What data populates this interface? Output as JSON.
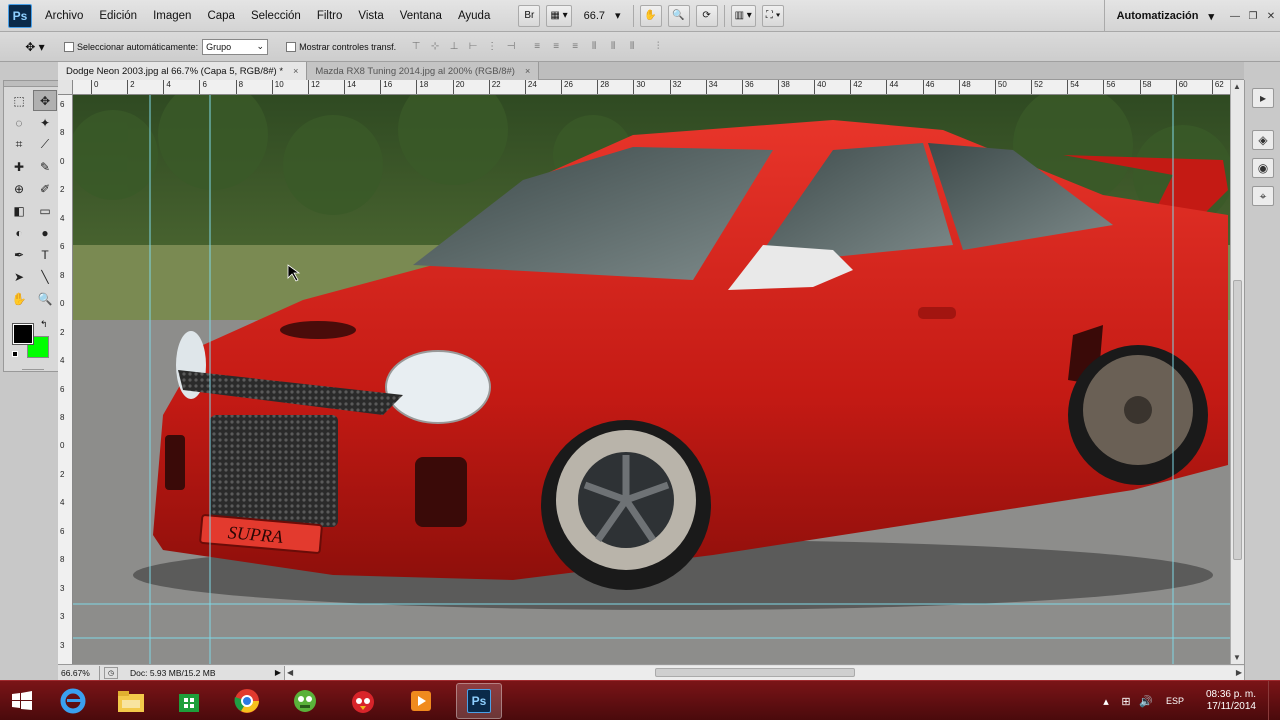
{
  "menubar": {
    "app_logo": "Ps",
    "items": [
      "Archivo",
      "Edición",
      "Imagen",
      "Capa",
      "Selección",
      "Filtro",
      "Vista",
      "Ventana",
      "Ayuda"
    ],
    "bridge_label": "Br",
    "zoom": "66.7",
    "automation": "Automatización"
  },
  "options": {
    "auto_select_label": "Seleccionar automáticamente:",
    "auto_select_value": "Grupo",
    "show_transform_label": "Mostrar controles transf."
  },
  "tabs": [
    {
      "label": "Dodge Neon 2003.jpg al 66.7% (Capa 5, RGB/8#) *",
      "close": "×"
    },
    {
      "label": "Mazda RX8 Tuning 2014.jpg al 200% (RGB/8#)",
      "close": "×"
    }
  ],
  "ruler_top": [
    "0",
    "2",
    "4",
    "6",
    "8",
    "10",
    "12",
    "14",
    "16",
    "18",
    "20",
    "22",
    "24",
    "26",
    "28",
    "30",
    "32",
    "34",
    "36",
    "38",
    "40",
    "42",
    "44",
    "46",
    "48",
    "50",
    "52",
    "54",
    "56",
    "58",
    "60",
    "62"
  ],
  "ruler_left": [
    "6",
    "8",
    "0",
    "2",
    "4",
    "6",
    "8",
    "0",
    "2",
    "4",
    "6",
    "8",
    "0",
    "2",
    "4",
    "6",
    "8",
    "3",
    "3",
    "3"
  ],
  "image": {
    "plate_text": "SUPRA"
  },
  "colors": {
    "foreground": "#000000",
    "background": "#00ff00",
    "car_body": "#d8201a",
    "taskbar": "#6a1012"
  },
  "status": {
    "zoom": "66.67%",
    "doc": "Doc: 5.93 MB/15.2 MB"
  },
  "taskbar": {
    "apps": [
      "ie-icon",
      "explorer-icon",
      "store-icon",
      "chrome-icon",
      "game-icon",
      "angry-birds-icon",
      "media-icon",
      "photoshop-icon"
    ],
    "photoshop_label": "Ps",
    "language": "ESP",
    "time": "08:36 p. m.",
    "date": "17/11/2014"
  }
}
